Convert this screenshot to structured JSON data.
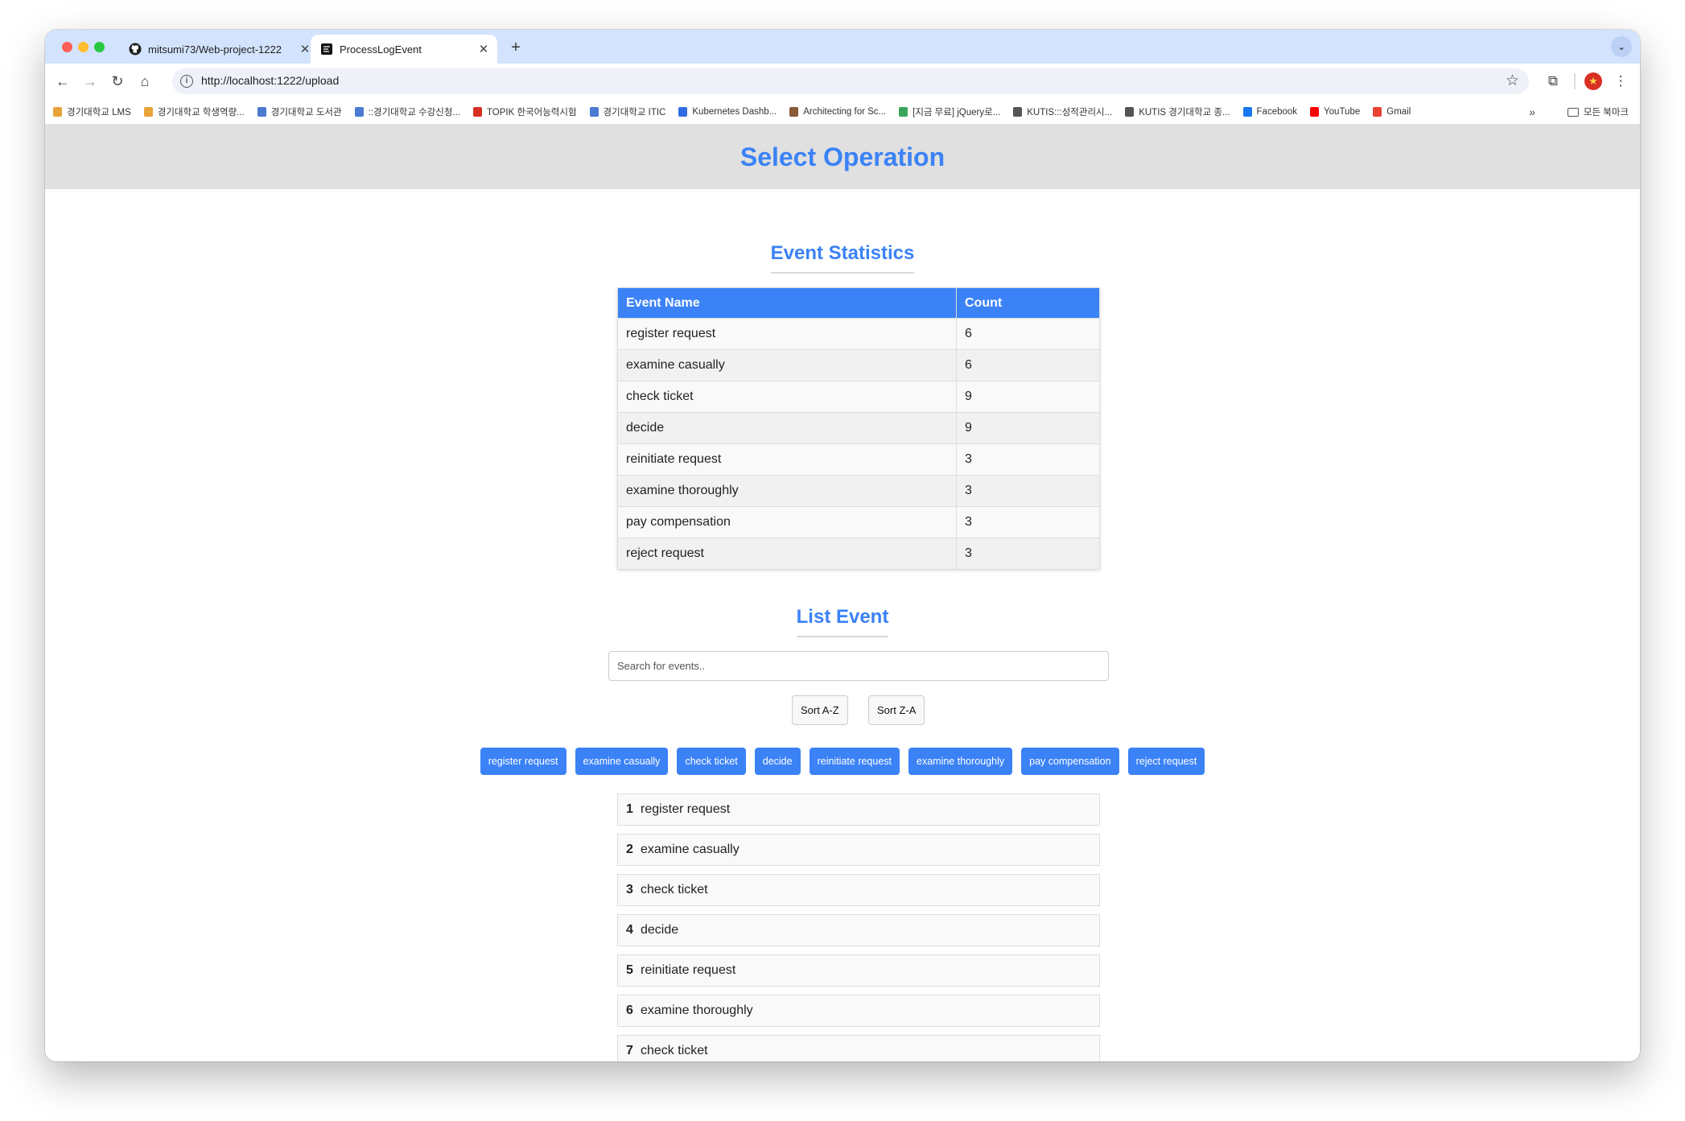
{
  "browser": {
    "tabs": [
      {
        "title": "mitsumi73/Web-project-1222",
        "icon": "github-icon"
      },
      {
        "title": "ProcessLogEvent",
        "icon": "page-favicon"
      }
    ],
    "url": "http://localhost:1222/upload",
    "bookmarks": [
      {
        "label": "경기대학교 LMS",
        "color": "#e8a33b"
      },
      {
        "label": "경기대학교 학생역량...",
        "color": "#e8a33b"
      },
      {
        "label": "경기대학교 도서관",
        "color": "#4a7bd0"
      },
      {
        "label": "::경기대학교 수강신청...",
        "color": "#4a7bd0"
      },
      {
        "label": "TOPIK 한국어능력시험",
        "color": "#d93025"
      },
      {
        "label": "경기대학교 ITIC",
        "color": "#4a7bd0"
      },
      {
        "label": "Kubernetes Dashb...",
        "color": "#326ce5"
      },
      {
        "label": "Architecting for Sc...",
        "color": "#8a5a3c"
      },
      {
        "label": "[지금 무료] jQuery로...",
        "color": "#3aa65c"
      },
      {
        "label": "KUTIS:::성적관리시...",
        "color": "#555555"
      },
      {
        "label": "KUTIS 경기대학교 종...",
        "color": "#555555"
      },
      {
        "label": "Facebook",
        "color": "#1877f2"
      },
      {
        "label": "YouTube",
        "color": "#ff0000"
      },
      {
        "label": "Gmail",
        "color": "#ea4335"
      }
    ],
    "bookmarks_more": "»",
    "all_bookmarks": "모든 북마크"
  },
  "page": {
    "header_title": "Select Operation",
    "stats_title": "Event Statistics",
    "stats_columns": [
      "Event Name",
      "Count"
    ],
    "stats_rows": [
      [
        "register request",
        "6"
      ],
      [
        "examine casually",
        "6"
      ],
      [
        "check ticket",
        "9"
      ],
      [
        "decide",
        "9"
      ],
      [
        "reinitiate request",
        "3"
      ],
      [
        "examine thoroughly",
        "3"
      ],
      [
        "pay compensation",
        "3"
      ],
      [
        "reject request",
        "3"
      ]
    ],
    "list_title": "List Event",
    "search_placeholder": "Search for events..",
    "sort_az": "Sort A-Z",
    "sort_za": "Sort Z-A",
    "filter_chips": [
      "register request",
      "examine casually",
      "check ticket",
      "decide",
      "reinitiate request",
      "examine thoroughly",
      "pay compensation",
      "reject request"
    ],
    "events": [
      {
        "num": "1",
        "name": "register request"
      },
      {
        "num": "2",
        "name": "examine casually"
      },
      {
        "num": "3",
        "name": "check ticket"
      },
      {
        "num": "4",
        "name": "decide"
      },
      {
        "num": "5",
        "name": "reinitiate request"
      },
      {
        "num": "6",
        "name": "examine thoroughly"
      },
      {
        "num": "7",
        "name": "check ticket"
      }
    ],
    "accent_color": "#3b82f6"
  }
}
